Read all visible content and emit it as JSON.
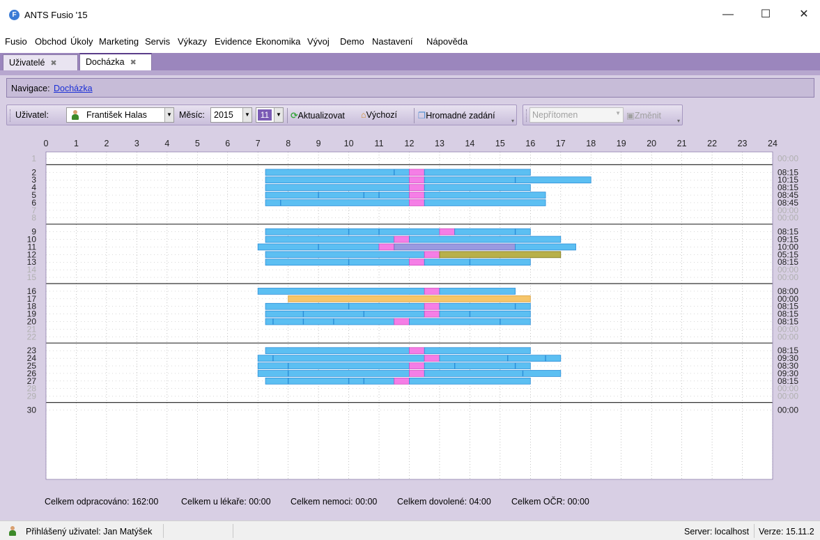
{
  "window": {
    "title": "ANTS Fusio '15",
    "logo_letter": "F",
    "minimize": "—",
    "maximize": "☐",
    "close": "✕"
  },
  "menu": [
    "Fusio",
    "Obchod",
    "Úkoly",
    "Marketing",
    "Servis",
    "Výkazy",
    "Evidence",
    "Ekonomika",
    "Vývoj",
    "Demo",
    "Nastavení",
    "Nápověda"
  ],
  "tabs": [
    {
      "label": "Uživatelé",
      "close": "✖",
      "active": false
    },
    {
      "label": "Docházka",
      "close": "✖",
      "active": true
    }
  ],
  "nav": {
    "label": "Navigace:",
    "link": "Docházka"
  },
  "toolbar": {
    "user_label": "Uživatel:",
    "user_value": "František Halas",
    "month_label": "Měsíc:",
    "year_value": "2015",
    "month_value": "11",
    "refresh": "Aktualizovat",
    "default": "Výchozí",
    "bulk": "Hromadné zadání",
    "absence_value": "Nepřítomen",
    "change": "Změnit"
  },
  "chart_data": {
    "type": "gantt",
    "x_ticks": [
      "0",
      "1",
      "2",
      "3",
      "4",
      "5",
      "6",
      "7",
      "8",
      "9",
      "10",
      "11",
      "12",
      "13",
      "14",
      "15",
      "16",
      "17",
      "18",
      "19",
      "20",
      "21",
      "22",
      "23",
      "24"
    ],
    "xlim": [
      0,
      24
    ],
    "rows": [
      {
        "day": "1",
        "total": "00:00",
        "weekend": true,
        "bars": [],
        "ticks": []
      },
      {
        "day": "2",
        "total": "08:15",
        "weekend": false,
        "bars": [
          [
            "work",
            7.25,
            12
          ],
          [
            "lunch",
            12,
            12.5
          ],
          [
            "work",
            12.5,
            16
          ]
        ],
        "ticks": [
          11.5
        ]
      },
      {
        "day": "3",
        "total": "10:15",
        "weekend": false,
        "bars": [
          [
            "work",
            7.25,
            12
          ],
          [
            "lunch",
            12,
            12.5
          ],
          [
            "work",
            12.5,
            18
          ]
        ],
        "ticks": [
          15.5
        ]
      },
      {
        "day": "4",
        "total": "08:15",
        "weekend": false,
        "bars": [
          [
            "work",
            7.25,
            12
          ],
          [
            "lunch",
            12,
            12.5
          ],
          [
            "work",
            12.5,
            16
          ]
        ],
        "ticks": []
      },
      {
        "day": "5",
        "total": "08:45",
        "weekend": false,
        "bars": [
          [
            "work",
            7.25,
            12
          ],
          [
            "lunch",
            12,
            12.5
          ],
          [
            "work",
            12.5,
            16.5
          ]
        ],
        "ticks": [
          9,
          10.5,
          11
        ]
      },
      {
        "day": "6",
        "total": "08:45",
        "weekend": false,
        "bars": [
          [
            "work",
            7.25,
            12
          ],
          [
            "lunch",
            12,
            12.5
          ],
          [
            "work",
            12.5,
            16.5
          ]
        ],
        "ticks": [
          7.75
        ]
      },
      {
        "day": "7",
        "total": "00:00",
        "weekend": true,
        "bars": [],
        "ticks": []
      },
      {
        "day": "8",
        "total": "00:00",
        "weekend": true,
        "bars": [],
        "ticks": []
      },
      {
        "day": "9",
        "total": "08:15",
        "weekend": false,
        "bars": [
          [
            "work",
            7.25,
            13
          ],
          [
            "lunch",
            13,
            13.5
          ],
          [
            "work",
            13.5,
            16
          ]
        ],
        "ticks": [
          10,
          11,
          15.5
        ]
      },
      {
        "day": "10",
        "total": "09:15",
        "weekend": false,
        "bars": [
          [
            "work",
            7.25,
            11.5
          ],
          [
            "lunch",
            11.5,
            12
          ],
          [
            "work",
            12,
            17
          ]
        ],
        "ticks": []
      },
      {
        "day": "11",
        "total": "10:00",
        "weekend": false,
        "bars": [
          [
            "work",
            7,
            11
          ],
          [
            "lunch",
            11,
            11.5
          ],
          [
            "other",
            11.5,
            15.5
          ],
          [
            "work",
            15.5,
            17.5
          ]
        ],
        "ticks": [
          9
        ]
      },
      {
        "day": "12",
        "total": "05:15",
        "weekend": false,
        "bars": [
          [
            "work",
            7.25,
            12.5
          ],
          [
            "lunch",
            12.5,
            13
          ],
          [
            "doctor",
            13,
            17
          ]
        ],
        "ticks": []
      },
      {
        "day": "13",
        "total": "08:15",
        "weekend": false,
        "bars": [
          [
            "work",
            7.25,
            12
          ],
          [
            "lunch",
            12,
            12.5
          ],
          [
            "work",
            12.5,
            16
          ]
        ],
        "ticks": [
          10,
          14
        ]
      },
      {
        "day": "14",
        "total": "00:00",
        "weekend": true,
        "bars": [],
        "ticks": []
      },
      {
        "day": "15",
        "total": "00:00",
        "weekend": true,
        "bars": [],
        "ticks": []
      },
      {
        "day": "16",
        "total": "08:00",
        "weekend": false,
        "bars": [
          [
            "work",
            7,
            12.5
          ],
          [
            "lunch",
            12.5,
            13
          ],
          [
            "work",
            13,
            15.5
          ]
        ],
        "ticks": []
      },
      {
        "day": "17",
        "total": "00:00",
        "weekend": false,
        "bars": [
          [
            "vacation",
            8,
            16
          ]
        ],
        "ticks": []
      },
      {
        "day": "18",
        "total": "08:15",
        "weekend": false,
        "bars": [
          [
            "work",
            7.25,
            12.5
          ],
          [
            "lunch",
            12.5,
            13
          ],
          [
            "work",
            13,
            16
          ]
        ],
        "ticks": [
          10,
          15.5
        ]
      },
      {
        "day": "19",
        "total": "08:15",
        "weekend": false,
        "bars": [
          [
            "work",
            7.25,
            12.5
          ],
          [
            "lunch",
            12.5,
            13
          ],
          [
            "work",
            13,
            16
          ]
        ],
        "ticks": [
          8.5,
          10.5,
          14
        ]
      },
      {
        "day": "20",
        "total": "08:15",
        "weekend": false,
        "bars": [
          [
            "work",
            7.25,
            11.5
          ],
          [
            "lunch",
            11.5,
            12
          ],
          [
            "work",
            12,
            16
          ]
        ],
        "ticks": [
          7.5,
          8.5,
          9.5,
          15
        ]
      },
      {
        "day": "21",
        "total": "00:00",
        "weekend": true,
        "bars": [],
        "ticks": []
      },
      {
        "day": "22",
        "total": "00:00",
        "weekend": true,
        "bars": [],
        "ticks": []
      },
      {
        "day": "23",
        "total": "08:15",
        "weekend": false,
        "bars": [
          [
            "work",
            7.25,
            12
          ],
          [
            "lunch",
            12,
            12.5
          ],
          [
            "work",
            12.5,
            16
          ]
        ],
        "ticks": []
      },
      {
        "day": "24",
        "total": "09:30",
        "weekend": false,
        "bars": [
          [
            "work",
            7,
            12.5
          ],
          [
            "lunch",
            12.5,
            13
          ],
          [
            "work",
            13,
            17
          ]
        ],
        "ticks": [
          7.5,
          15.25,
          16.5
        ]
      },
      {
        "day": "25",
        "total": "08:30",
        "weekend": false,
        "bars": [
          [
            "work",
            7,
            12
          ],
          [
            "lunch",
            12,
            12.5
          ],
          [
            "work",
            12.5,
            16
          ]
        ],
        "ticks": [
          8,
          13.5,
          15.5
        ]
      },
      {
        "day": "26",
        "total": "09:30",
        "weekend": false,
        "bars": [
          [
            "work",
            7,
            12
          ],
          [
            "lunch",
            12,
            12.5
          ],
          [
            "work",
            12.5,
            17
          ]
        ],
        "ticks": [
          8,
          15.75
        ]
      },
      {
        "day": "27",
        "total": "08:15",
        "weekend": false,
        "bars": [
          [
            "work",
            7.25,
            11.5
          ],
          [
            "lunch",
            11.5,
            12
          ],
          [
            "work",
            12,
            16
          ]
        ],
        "ticks": [
          8,
          10,
          10.5
        ]
      },
      {
        "day": "28",
        "total": "00:00",
        "weekend": true,
        "bars": [],
        "ticks": []
      },
      {
        "day": "29",
        "total": "00:00",
        "weekend": true,
        "bars": [],
        "ticks": []
      },
      {
        "day": "30",
        "total": "00:00",
        "weekend": false,
        "bars": [],
        "ticks": []
      }
    ],
    "week_separators_after_day": [
      "1",
      "8",
      "15",
      "22",
      "29"
    ],
    "colors": {
      "work": "#5cbff2",
      "lunch": "#f57ee6",
      "other": "#9a9ae0",
      "doctor": "#b8b04a",
      "vacation": "#f6c56a",
      "border": "#2c8ed8"
    }
  },
  "totals": [
    "Celkem odpracováno: 162:00",
    "Celkem u lékaře: 00:00",
    "Celkem nemoci: 00:00",
    "Celkem dovolené: 04:00",
    "Celkem OČR: 00:00"
  ],
  "status": {
    "user": "Přihlášený uživatel: Jan Matýšek",
    "server": "Server: localhost",
    "version": "Verze: 15.11.2"
  }
}
